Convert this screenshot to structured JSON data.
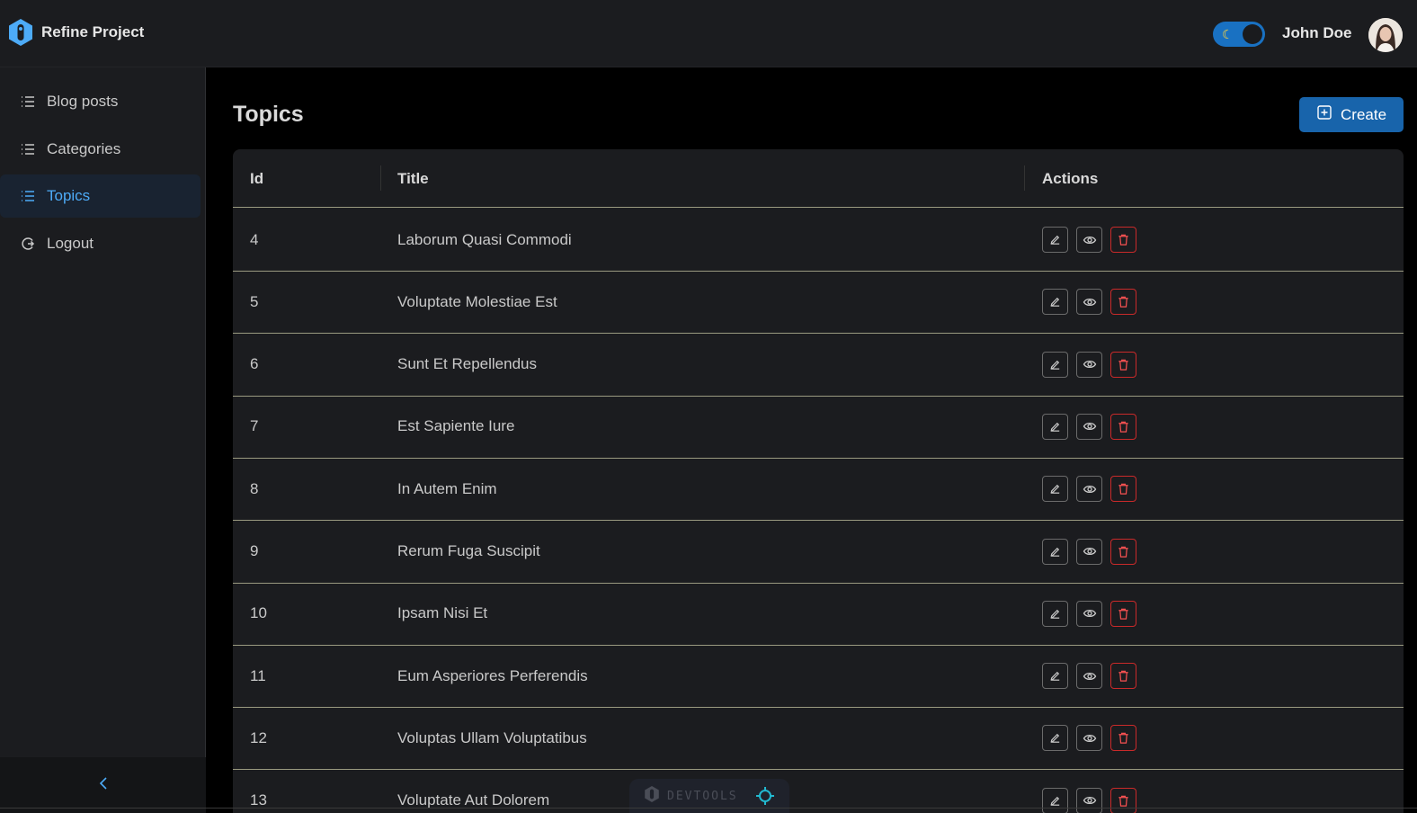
{
  "header": {
    "brand_title": "Refine Project",
    "user_name": "John Doe",
    "theme_toggle": {
      "mode": "dark",
      "icon": "moon-icon"
    }
  },
  "sidebar": {
    "items": [
      {
        "label": "Blog posts",
        "icon": "list-icon",
        "active": false
      },
      {
        "label": "Categories",
        "icon": "list-icon",
        "active": false
      },
      {
        "label": "Topics",
        "icon": "list-icon",
        "active": true
      },
      {
        "label": "Logout",
        "icon": "logout-icon",
        "active": false
      }
    ],
    "collapse_icon": "chevron-left-icon"
  },
  "main": {
    "title": "Topics",
    "create_label": "Create",
    "table": {
      "columns": [
        "Id",
        "Title",
        "Actions"
      ],
      "rows": [
        {
          "id": "4",
          "title": "Laborum Quasi Commodi"
        },
        {
          "id": "5",
          "title": "Voluptate Molestiae Est"
        },
        {
          "id": "6",
          "title": "Sunt Et Repellendus"
        },
        {
          "id": "7",
          "title": "Est Sapiente Iure"
        },
        {
          "id": "8",
          "title": "In Autem Enim"
        },
        {
          "id": "9",
          "title": "Rerum Fuga Suscipit"
        },
        {
          "id": "10",
          "title": "Ipsam Nisi Et"
        },
        {
          "id": "11",
          "title": "Eum Asperiores Perferendis"
        },
        {
          "id": "12",
          "title": "Voluptas Ullam Voluptatibus"
        },
        {
          "id": "13",
          "title": "Voluptate Aut Dolorem"
        }
      ]
    }
  },
  "devtools": {
    "label": "DEVTOOLS"
  },
  "colors": {
    "accent": "#1864ab",
    "active_text": "#4dabf7",
    "danger": "#c92a2a",
    "background": "#000000",
    "surface": "#1b1c1f"
  }
}
